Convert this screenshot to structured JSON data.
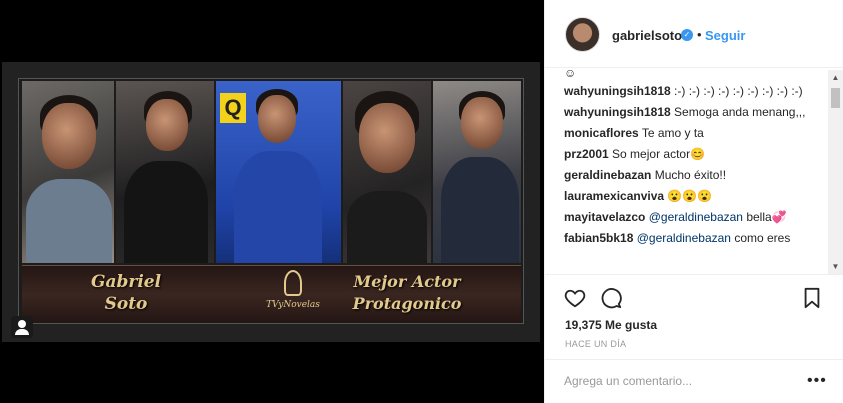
{
  "post": {
    "logo_text": "TVyNovelas",
    "banner_name": "Gabriel Soto",
    "banner_award": "Mejor Actor Protagonico"
  },
  "header": {
    "username": "gabrielsoto",
    "verified": "✓",
    "separator": "•",
    "follow_label": "Seguir"
  },
  "comments": {
    "top_fragment": "☺",
    "items": [
      {
        "user": "wahyuningsih1818",
        "text": ":-) :-) :-) :-) :-) :-) :-) :-) :-)"
      },
      {
        "user": "wahyuningsih1818",
        "text": "Semoga anda menang,,,"
      },
      {
        "user": "monicaflores",
        "text": "Te amo y ta"
      },
      {
        "user": "prz2001",
        "text": "So mejor actor😊"
      },
      {
        "user": "geraldinebazan",
        "text": "Mucho éxito!!"
      },
      {
        "user": "lauramexicanviva",
        "text": "😮😮😮"
      },
      {
        "user": "mayitavelazco",
        "mention": "@geraldinebazan",
        "text": "bella💞"
      },
      {
        "user": "fabian5bk18",
        "mention": "@geraldinebazan",
        "text": "como eres"
      }
    ]
  },
  "stats": {
    "likes": "19,375 Me gusta",
    "timestamp": "HACE UN DÍA"
  },
  "add_comment": {
    "placeholder": "Agrega un comentario...",
    "more": "•••"
  },
  "icons": {
    "heart": "heart-icon",
    "comment": "comment-icon",
    "save": "bookmark-icon",
    "more": "more-icon"
  }
}
